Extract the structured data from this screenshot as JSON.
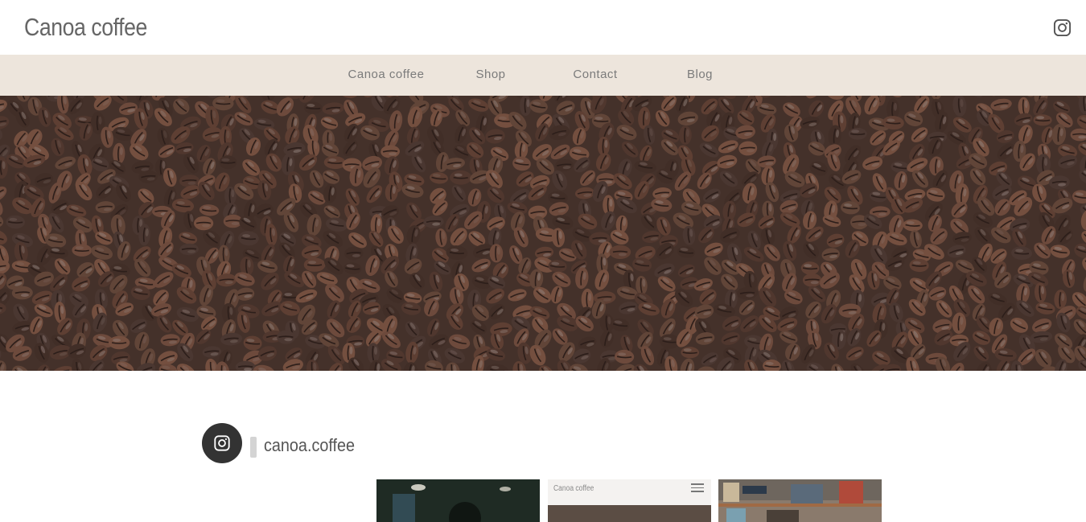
{
  "header": {
    "site_title": "Canoa coffee",
    "instagram_icon": "instagram-icon"
  },
  "nav": {
    "items": [
      {
        "label": "Canoa coffee"
      },
      {
        "label": "Shop"
      },
      {
        "label": "Contact"
      },
      {
        "label": "Blog"
      }
    ]
  },
  "hero": {
    "image": "coffee-beans-photo"
  },
  "instagram": {
    "handle": "canoa.coffee",
    "icon": "instagram-icon",
    "thumbnails": [
      {
        "image": "cafe-interior-photo"
      },
      {
        "image": "website-screenshot-photo",
        "title": "Canoa coffee"
      },
      {
        "image": "shelf-photo"
      }
    ]
  },
  "colors": {
    "nav_bg": "#ede5dc",
    "avatar_bg": "#333333",
    "text": "#666666"
  }
}
